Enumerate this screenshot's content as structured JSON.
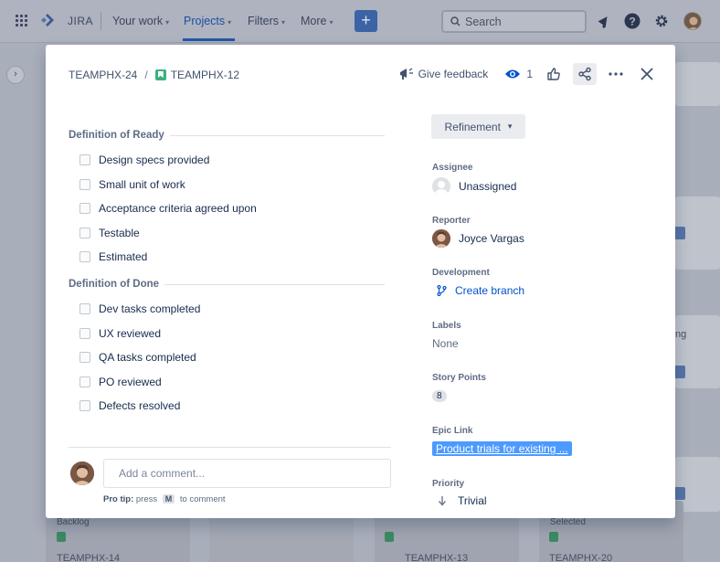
{
  "topnav": {
    "product": "JIRA",
    "items": [
      {
        "label": "Your work",
        "active": false
      },
      {
        "label": "Projects",
        "active": true
      },
      {
        "label": "Filters",
        "active": false
      },
      {
        "label": "More",
        "active": false
      }
    ],
    "create_label": "+",
    "search_placeholder": "Search"
  },
  "board": {
    "sidebar_toggle": "›",
    "background_text": [
      "TEAMPHX-14",
      "TEAMPHX-13",
      "TEAMPHX-20",
      "Backlog",
      "Selected",
      "ng"
    ]
  },
  "modal": {
    "breadcrumb": {
      "parent": "TEAMPHX-24",
      "separator": "/",
      "issue": "TEAMPHX-12"
    },
    "toolbar": {
      "feedback_label": "Give feedback",
      "watch_count": "1"
    },
    "definition_of_ready": {
      "heading": "Definition of Ready",
      "items": [
        "Design specs provided",
        "Small unit of work",
        "Acceptance criteria agreed upon",
        "Testable",
        "Estimated"
      ]
    },
    "definition_of_done": {
      "heading": "Definition of Done",
      "items": [
        "Dev tasks completed",
        "UX reviewed",
        "QA tasks completed",
        "PO reviewed",
        "Defects resolved"
      ]
    },
    "comment": {
      "placeholder": "Add a comment...",
      "pro_tip_prefix": "Pro tip:",
      "pro_tip_press": "press",
      "pro_tip_key": "M",
      "pro_tip_suffix": "to comment"
    },
    "status": "Refinement",
    "fields": {
      "assignee": {
        "label": "Assignee",
        "value": "Unassigned"
      },
      "reporter": {
        "label": "Reporter",
        "value": "Joyce Vargas"
      },
      "development": {
        "label": "Development",
        "value": "Create branch"
      },
      "labels": {
        "label": "Labels",
        "value": "None"
      },
      "story_points": {
        "label": "Story Points",
        "value": "8"
      },
      "epic_link": {
        "label": "Epic Link",
        "value": "Product trials for existing ..."
      },
      "priority": {
        "label": "Priority",
        "value": "Trivial"
      }
    }
  },
  "colors": {
    "accent": "#0052cc",
    "story_green": "#36b37e",
    "epic_blue": "#4c9aff"
  }
}
